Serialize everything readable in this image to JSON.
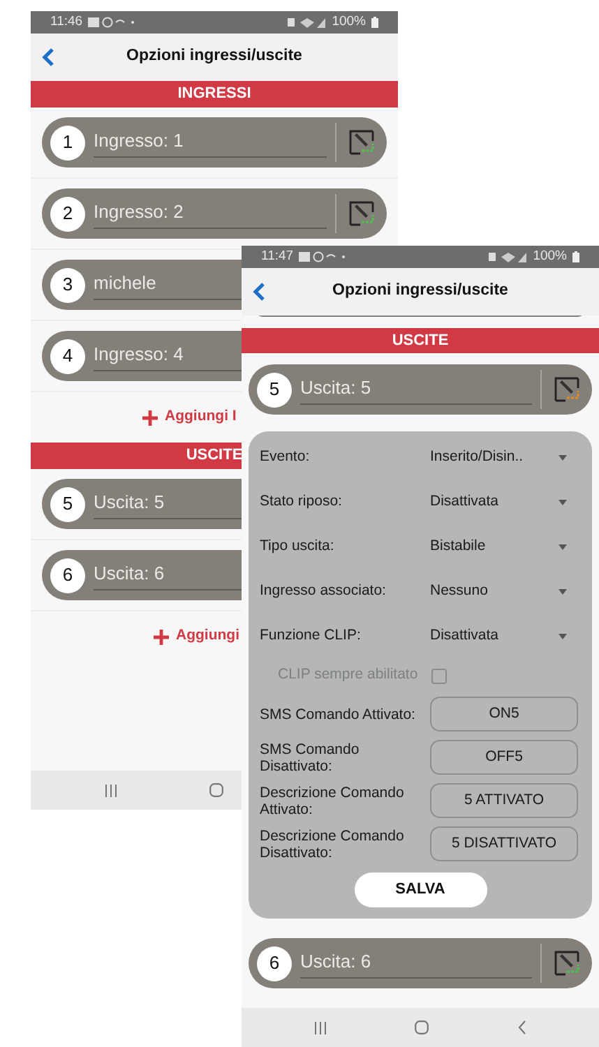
{
  "back_screen": {
    "status_bar": {
      "time": "11:46",
      "battery": "100%"
    },
    "title": "Opzioni ingressi/uscite",
    "sections": [
      {
        "header": "INGRESSI",
        "add_label": "Aggiungi I",
        "items": [
          {
            "number": "1",
            "name": "Ingresso: 1",
            "edit_button": true
          },
          {
            "number": "2",
            "name": "Ingresso: 2",
            "edit_button": true
          },
          {
            "number": "3",
            "name": "michele",
            "edit_button": false
          },
          {
            "number": "4",
            "name": "Ingresso: 4",
            "edit_button": false
          }
        ]
      },
      {
        "header": "USCITE",
        "add_label": "Aggiungi",
        "items": [
          {
            "number": "5",
            "name": "Uscita: 5",
            "edit_button": false
          },
          {
            "number": "6",
            "name": "Uscita: 6",
            "edit_button": false
          }
        ]
      }
    ]
  },
  "front_screen": {
    "status_bar": {
      "time": "11:47",
      "battery": "100%"
    },
    "title": "Opzioni ingressi/uscite",
    "section_header": "USCITE",
    "items": [
      {
        "number": "5",
        "name": "Uscita: 5",
        "expanded": true,
        "save_button": "SALVA",
        "fields": [
          {
            "kind": "select",
            "label": "Evento:",
            "value": "Inserito/Disin.."
          },
          {
            "kind": "select",
            "label": "Stato riposo:",
            "value": "Disattivata"
          },
          {
            "kind": "select",
            "label": "Tipo uscita:",
            "value": "Bistabile"
          },
          {
            "kind": "select",
            "label": "Ingresso associato:",
            "value": "Nessuno"
          },
          {
            "kind": "select",
            "label": "Funzione CLIP:",
            "value": "Disattivata"
          },
          {
            "kind": "checkbox",
            "label": "CLIP sempre abilitato",
            "checked": false,
            "disabled": true
          },
          {
            "kind": "text",
            "label": "SMS Comando Attivato:",
            "value": "ON5"
          },
          {
            "kind": "text",
            "label": "SMS Comando Disattivato:",
            "value": "OFF5"
          },
          {
            "kind": "text",
            "label": "Descrizione Comando Attivato:",
            "value": "5 ATTIVATO"
          },
          {
            "kind": "text",
            "label": "Descrizione Comando Disattivato:",
            "value": "5 DISATTIVATO"
          }
        ]
      },
      {
        "number": "6",
        "name": "Uscita: 6",
        "expanded": false
      }
    ]
  }
}
